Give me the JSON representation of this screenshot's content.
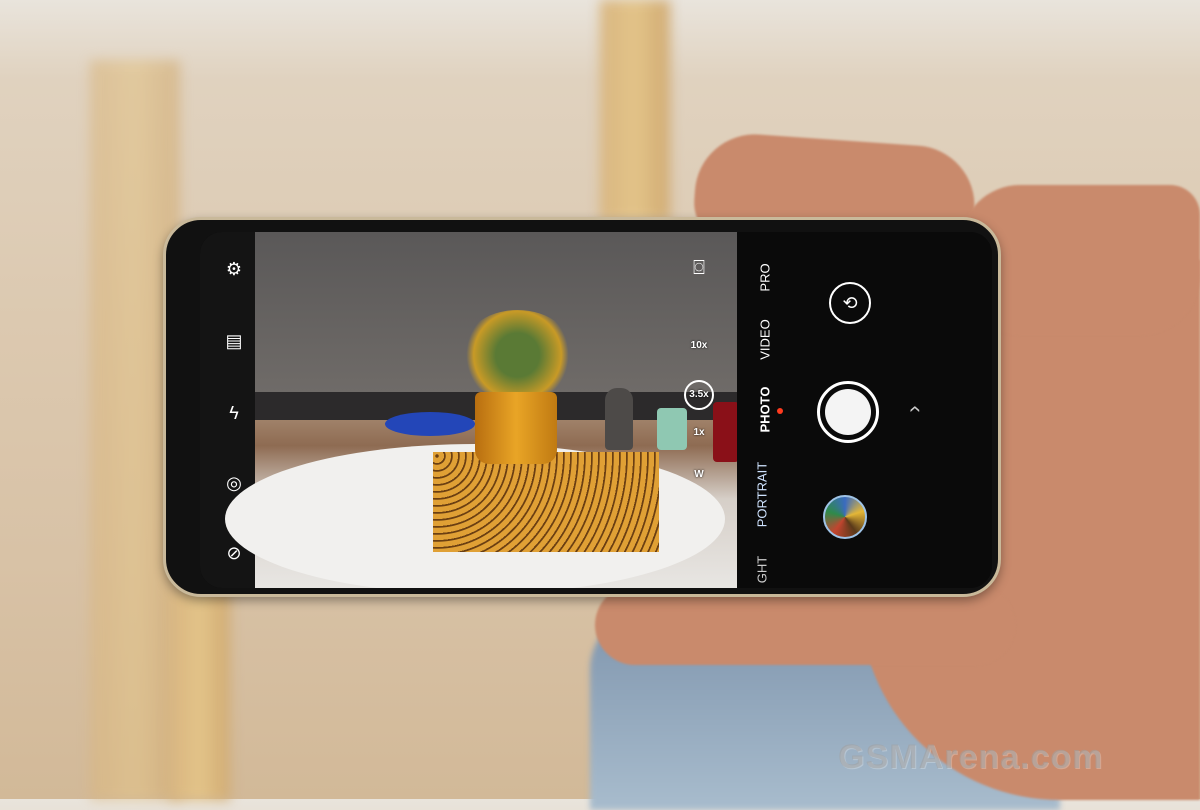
{
  "camera_ui": {
    "left_toolbar": [
      {
        "icon": "gear-icon",
        "symbol": "⚙"
      },
      {
        "icon": "film-icon",
        "symbol": "▤"
      },
      {
        "icon": "flash-off-icon",
        "symbol": "ϟ"
      },
      {
        "icon": "filter-off-icon",
        "symbol": "◎"
      },
      {
        "icon": "ai-off-icon",
        "symbol": "⊘"
      }
    ],
    "focus_icon": "⌼",
    "zoom_levels": [
      "10x",
      "3.5x",
      "1x",
      "W"
    ],
    "selected_zoom": "3.5x",
    "modes": [
      "PRO",
      "VIDEO",
      "PHOTO",
      "PORTRAIT",
      "GHT"
    ],
    "active_mode": "PHOTO",
    "flip_symbol": "⟲",
    "expand_symbol": "‹",
    "accent_color": "#ff3b1f"
  },
  "watermark": "GSMArena.com"
}
